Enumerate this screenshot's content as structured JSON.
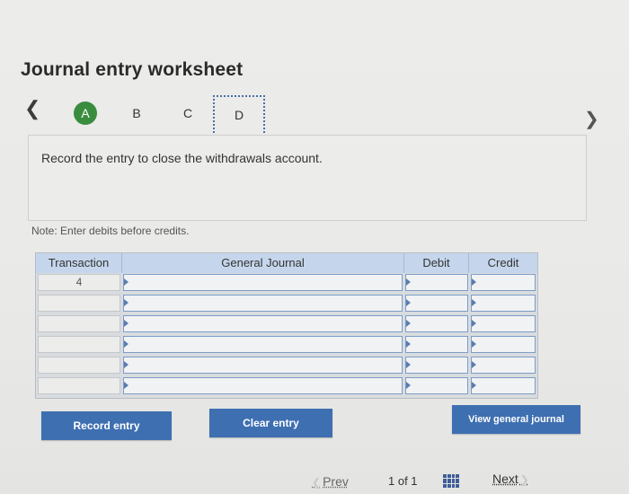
{
  "page": {
    "title": "Journal entry worksheet",
    "tabs": [
      "A",
      "B",
      "C",
      "D"
    ],
    "active_tab": "A",
    "prompt": "Record the entry to close the withdrawals account.",
    "note": "Note: Enter debits before credits."
  },
  "table": {
    "headers": {
      "transaction": "Transaction",
      "general_journal": "General Journal",
      "debit": "Debit",
      "credit": "Credit"
    },
    "rows": [
      {
        "transaction": "4",
        "general_journal": "",
        "debit": "",
        "credit": ""
      },
      {
        "transaction": "",
        "general_journal": "",
        "debit": "",
        "credit": ""
      },
      {
        "transaction": "",
        "general_journal": "",
        "debit": "",
        "credit": ""
      },
      {
        "transaction": "",
        "general_journal": "",
        "debit": "",
        "credit": ""
      },
      {
        "transaction": "",
        "general_journal": "",
        "debit": "",
        "credit": ""
      },
      {
        "transaction": "",
        "general_journal": "",
        "debit": "",
        "credit": ""
      }
    ]
  },
  "buttons": {
    "record": "Record entry",
    "clear": "Clear entry",
    "view": "View general journal"
  },
  "pager": {
    "prev": "Prev",
    "count": "1 of 1",
    "next": "Next"
  },
  "colors": {
    "accent": "#3e6fb1",
    "active_tab": "#3a8d3f",
    "header_bg": "#c5d6ec"
  }
}
